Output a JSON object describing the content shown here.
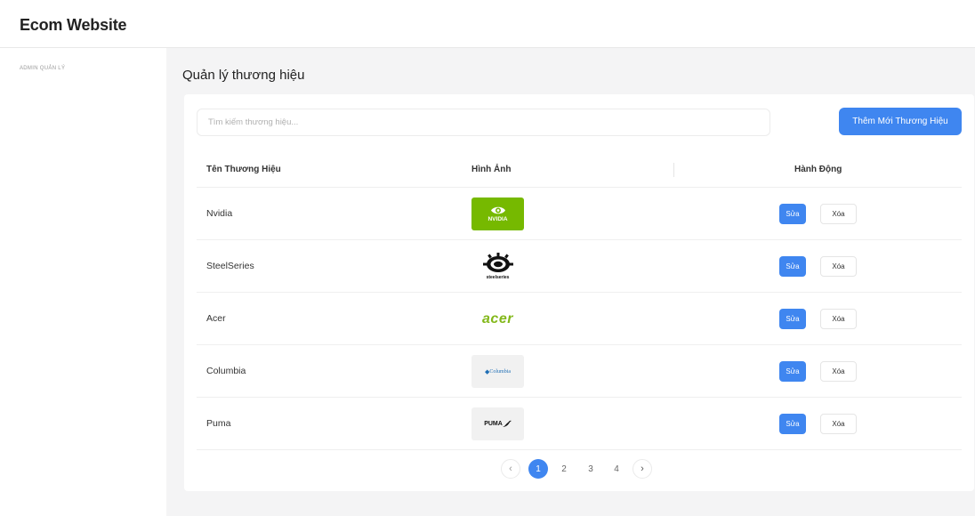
{
  "app": {
    "title": "Ecom Website",
    "sidebar_label": "ADMIN QUẢN LÝ"
  },
  "page": {
    "title": "Quản lý thương hiệu"
  },
  "search": {
    "placeholder": "Tìm kiếm thương hiệu..."
  },
  "actions": {
    "add_label": "Thêm Mới Thương Hiệu"
  },
  "table": {
    "headers": {
      "name": "Tên Thương Hiệu",
      "image": "Hình Ảnh",
      "action": "Hành Động"
    },
    "rows": [
      {
        "name": "Nvidia",
        "logo_text": "NVIDIA",
        "logo_bg": "#76b900",
        "edit": "Sửa",
        "delete": "Xóa"
      },
      {
        "name": "SteelSeries",
        "logo_text": "steelseries",
        "logo_bg": "#ffffff",
        "edit": "Sửa",
        "delete": "Xóa"
      },
      {
        "name": "Acer",
        "logo_text": "acer",
        "logo_bg": "#ffffff",
        "edit": "Sửa",
        "delete": "Xóa"
      },
      {
        "name": "Columbia",
        "logo_text": "Columbia",
        "logo_bg": "#f1f1f1",
        "edit": "Sửa",
        "delete": "Xóa"
      },
      {
        "name": "Puma",
        "logo_text": "PUMA",
        "logo_bg": "#f1f1f1",
        "edit": "Sửa",
        "delete": "Xóa"
      }
    ]
  },
  "pagination": {
    "prev": "‹",
    "pages": [
      "1",
      "2",
      "3",
      "4"
    ],
    "current": "1",
    "next": "›"
  },
  "colors": {
    "accent": "#3f86f0",
    "nvidia_green": "#76b900",
    "acer_green": "#83b81a",
    "columbia_blue": "#1f6fb5"
  }
}
